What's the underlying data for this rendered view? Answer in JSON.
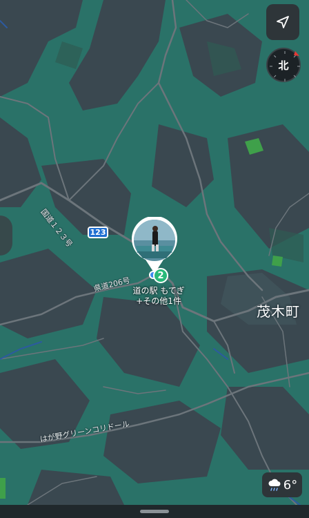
{
  "map": {
    "town_label": "茂木町",
    "road_labels": {
      "national_route": "国道１２３号",
      "prefectural_road": "県道206号",
      "green_corridor": "はが野グリーンコリドール"
    },
    "route_shield": "123",
    "pin": {
      "cluster_count": "2",
      "caption_line1": "道の駅 もてぎ",
      "caption_line2": "+その他1件"
    },
    "colors": {
      "forest": "#2a7268",
      "open_land": "#3a4850",
      "road": "#6c757b",
      "route_shield": "#1f6fd1",
      "cluster_badge": "#2ab97a"
    }
  },
  "controls": {
    "locate_icon": "location-arrow-icon",
    "compass_label": "北",
    "weather": {
      "icon": "rain-cloud-icon",
      "temperature": "6°"
    }
  }
}
